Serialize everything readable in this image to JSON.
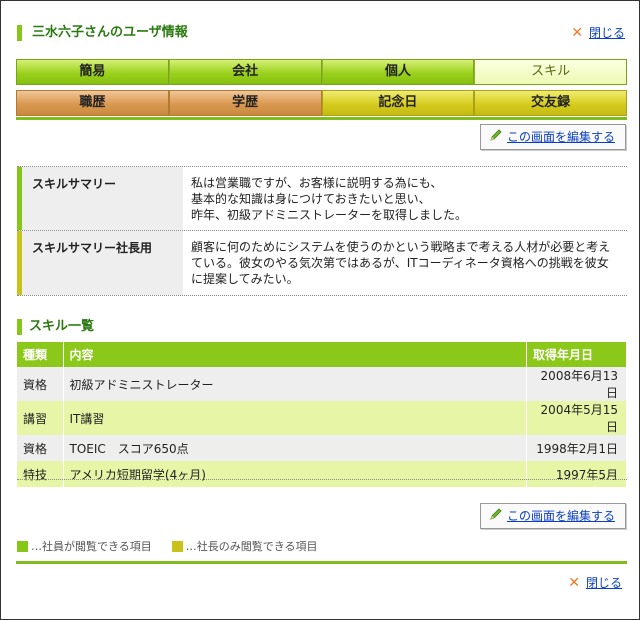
{
  "header": {
    "title": "三水六子さんのユーザ情報",
    "close_label": "閉じる"
  },
  "tabs_row1": [
    {
      "label": "簡易",
      "active": false
    },
    {
      "label": "会社",
      "active": false
    },
    {
      "label": "個人",
      "active": false
    },
    {
      "label": "スキル",
      "active": true
    }
  ],
  "tabs_row2": [
    {
      "label": "職歴",
      "color": "brown"
    },
    {
      "label": "学歴",
      "color": "brown"
    },
    {
      "label": "記念日",
      "color": "olive"
    },
    {
      "label": "交友録",
      "color": "olive"
    }
  ],
  "edit_label": "この画面を編集する",
  "summary": [
    {
      "label": "スキルサマリー",
      "lines": [
        "私は営業職ですが、お客様に説明する為にも、",
        "基本的な知識は身につけておきたいと思い、",
        "昨年、初級アドミニストレーターを取得しました。"
      ]
    },
    {
      "label": "スキルサマリー社長用",
      "lines": [
        "顧客に何のためにシステムを使うのかという戦略まで考える人材が必要と考え",
        "ている。彼女のやる気次第ではあるが、ITコーディネータ資格への挑戦を彼女",
        "に提案してみたい。"
      ]
    }
  ],
  "skills_section_title": "スキル一覧",
  "skills_table": {
    "headers": [
      "種類",
      "内容",
      "取得年月日"
    ],
    "rows": [
      [
        "資格",
        "初級アドミニストレーター",
        "2008年6月13日"
      ],
      [
        "講習",
        "IT講習",
        "2004年5月15日"
      ],
      [
        "資格",
        "TOEIC　スコア650点",
        "1998年2月1日"
      ],
      [
        "特技",
        "アメリカ短期留学(4ヶ月)",
        "1997年5月"
      ]
    ]
  },
  "legend": {
    "employee": "…社員が閲覧できる項目",
    "president": "…社長のみ閲覧できる項目"
  },
  "colors": {
    "accent_green": "#86c617",
    "accent_olive": "#c9c21a",
    "link": "#0b3fc4",
    "close_icon": "#ee7a2a"
  }
}
